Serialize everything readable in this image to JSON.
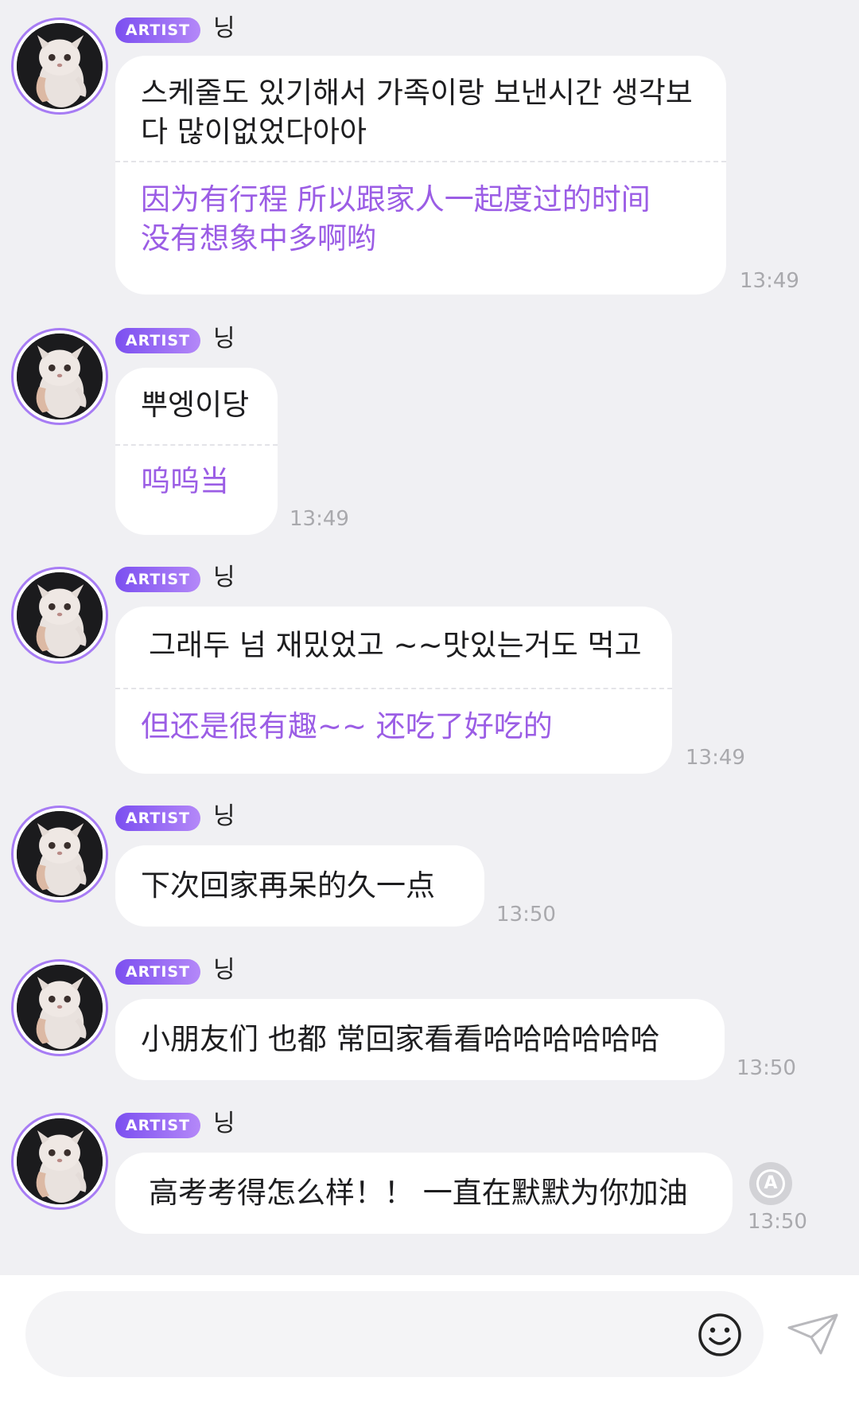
{
  "badge_label": "ARTIST",
  "messages": [
    {
      "name": "닝",
      "original": "스케줄도 있기해서 가족이랑 보낸시간 생각보\n다 많이없었다아아",
      "translation": "因为有行程 所以跟家人一起度过的时间\n没有想象中多啊哟",
      "time": "13:49"
    },
    {
      "name": "닝",
      "original": "뿌엥이당",
      "translation": "呜呜当",
      "time": "13:49"
    },
    {
      "name": "닝",
      "original": "그래두 넘 재밌었고 ~~맛있는거도 먹고",
      "translation": "但还是很有趣~~ 还吃了好吃的",
      "time": "13:49"
    },
    {
      "name": "닝",
      "original": "下次回家再呆的久一点",
      "time": "13:50"
    },
    {
      "name": "닝",
      "original": "小朋友们 也都 常回家看看哈哈哈哈哈哈",
      "time": "13:50"
    },
    {
      "name": "닝",
      "original": "高考考得怎么样！！ 一直在默默为你加油",
      "time": "13:50"
    }
  ],
  "translate_button_glyph": "A",
  "composer": {
    "placeholder": "",
    "emoji_icon": "smiley-icon",
    "send_icon": "paper-plane-icon"
  },
  "colors": {
    "background": "#f0f0f3",
    "bubble": "#ffffff",
    "translation_text": "#9b5de5",
    "badge_start": "#7b4ff0",
    "badge_end": "#b488f8",
    "timestamp": "#a9a9ad"
  }
}
